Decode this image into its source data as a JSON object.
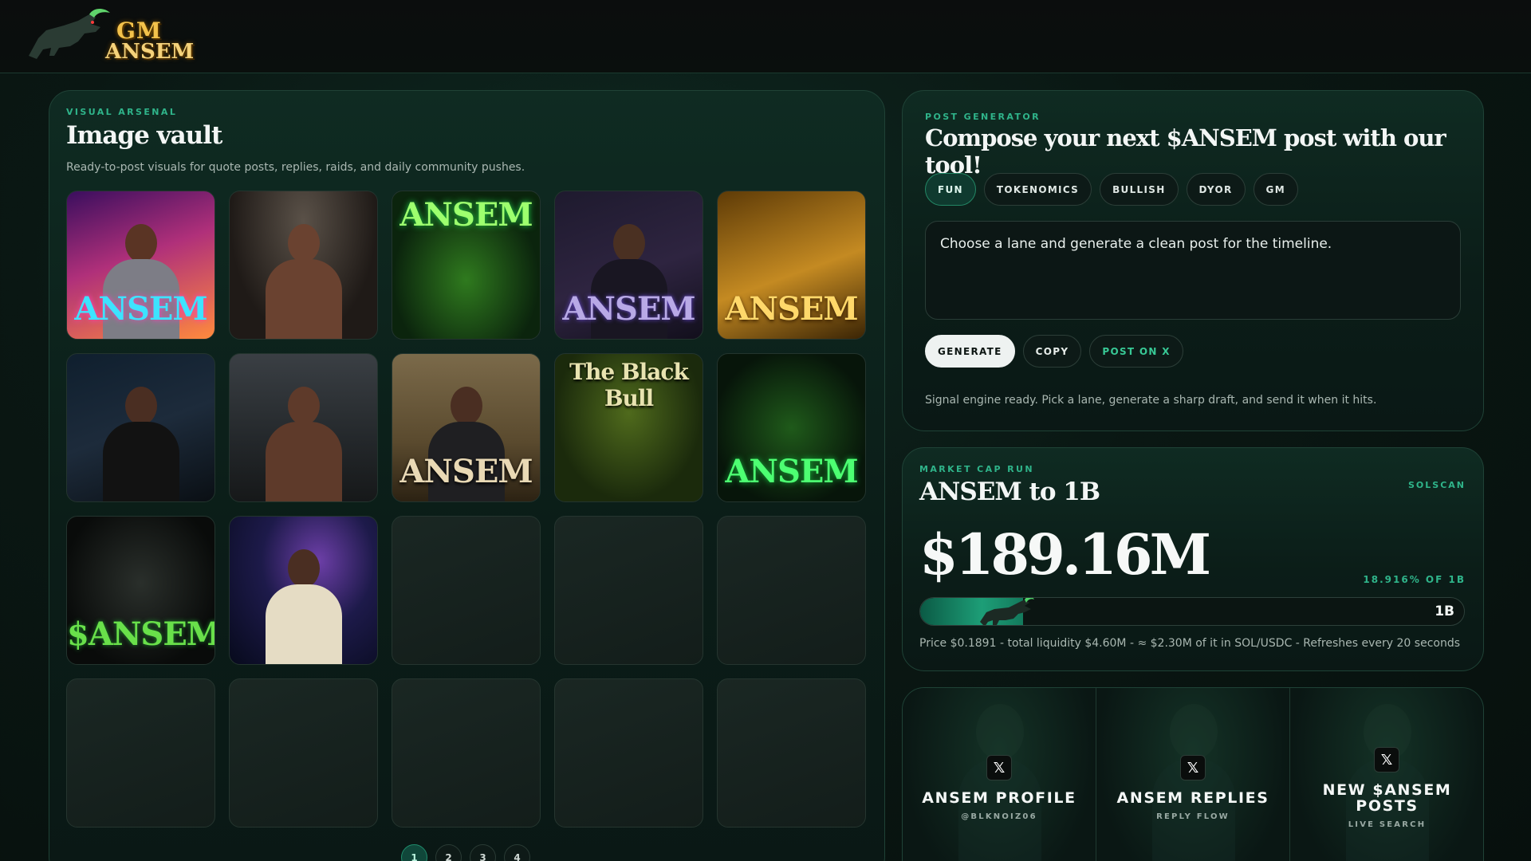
{
  "header": {
    "logo_line1": "GM",
    "logo_line2": "ANSEM"
  },
  "vault": {
    "eyebrow": "VISUAL ARSENAL",
    "title": "Image vault",
    "subtitle": "Ready-to-post visuals for quote posts, replies, raids, and daily community pushes.",
    "tiles": [
      {
        "label": "ANSEM",
        "theme": "synthwave"
      },
      {
        "label": "",
        "theme": "fight-night"
      },
      {
        "label": "ANSEM",
        "theme": "green-bull"
      },
      {
        "label": "ANSEM",
        "theme": "dark-lord"
      },
      {
        "label": "ANSEM",
        "theme": "gold-crown"
      },
      {
        "label": "",
        "theme": "portrait-night"
      },
      {
        "label": "",
        "theme": "back-gym"
      },
      {
        "label": "ANSEM",
        "theme": "field-suit"
      },
      {
        "label": "The Black Bull",
        "theme": "forest-rider"
      },
      {
        "label": "ANSEM",
        "theme": "green-coins"
      },
      {
        "label": "$ANSEM",
        "theme": "bull-head"
      },
      {
        "label": "",
        "theme": "galaxy"
      }
    ],
    "empty_tiles": 8,
    "pages": [
      "1",
      "2",
      "3",
      "4"
    ],
    "active_page": "1"
  },
  "post_generator": {
    "eyebrow": "POST GENERATOR",
    "title": "Compose your next $ANSEM post with our tool!",
    "chips": [
      "FUN",
      "TOKENOMICS",
      "BULLISH",
      "DYOR",
      "GM"
    ],
    "active_chip": "FUN",
    "composer_text": "Choose a lane and generate a clean post for the timeline.",
    "generate_label": "GENERATE",
    "copy_label": "COPY",
    "post_label": "POST ON X",
    "status": "Signal engine ready. Pick a lane, generate a sharp draft, and send it when it hits."
  },
  "market_cap": {
    "eyebrow": "MARKET CAP RUN",
    "title": "ANSEM to 1B",
    "solscan_label": "SOLSCAN",
    "value": "$189.16M",
    "percent_label": "18.916% OF 1B",
    "progress_fraction": 0.18916,
    "target_label": "1B",
    "note": "Price $0.1891 - total liquidity $4.60M - ≈ $2.30M of it in SOL/USDC - Refreshes every 20 seconds"
  },
  "links": [
    {
      "title": "ANSEM PROFILE",
      "sub": "@BLKNOIZ06",
      "icon": "x-logo-icon"
    },
    {
      "title": "ANSEM REPLIES",
      "sub": "REPLY FLOW",
      "icon": "x-logo-icon"
    },
    {
      "title": "NEW $ANSEM POSTS",
      "sub": "LIVE SEARCH",
      "icon": "x-logo-icon"
    }
  ],
  "colors": {
    "accent": "#2fb48a",
    "background": "#0a1713",
    "gold": "#f3c24b"
  }
}
